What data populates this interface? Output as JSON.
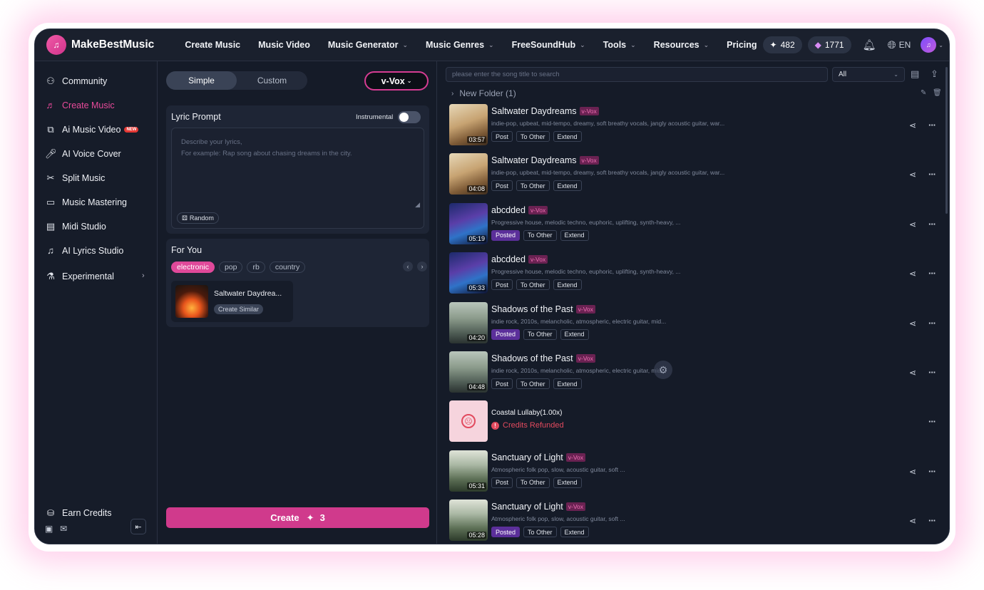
{
  "brand": {
    "name": "MakeBestMusic",
    "logo_icon": "music-note-logo"
  },
  "topnav": {
    "items": [
      {
        "label": "Create Music",
        "has_menu": false
      },
      {
        "label": "Music Video",
        "has_menu": false
      },
      {
        "label": "Music Generator",
        "has_menu": true
      },
      {
        "label": "Music Genres",
        "has_menu": true
      },
      {
        "label": "FreeSoundHub",
        "has_menu": true
      },
      {
        "label": "Tools",
        "has_menu": true
      },
      {
        "label": "Resources",
        "has_menu": true
      },
      {
        "label": "Pricing",
        "has_menu": false
      }
    ],
    "credits": "482",
    "gems": "1771",
    "language": "EN"
  },
  "sidebar": {
    "items": [
      {
        "label": "Community",
        "icon": "community-icon"
      },
      {
        "label": "Create Music",
        "icon": "music-note-icon",
        "active": true
      },
      {
        "label": "Ai Music Video",
        "icon": "video-icon",
        "badge": "NEW"
      },
      {
        "label": "AI Voice Cover",
        "icon": "microphone-icon"
      },
      {
        "label": "Split Music",
        "icon": "split-icon"
      },
      {
        "label": "Music Mastering",
        "icon": "mastering-icon"
      },
      {
        "label": "Midi Studio",
        "icon": "midi-icon"
      },
      {
        "label": "AI Lyrics Studio",
        "icon": "lyrics-icon"
      },
      {
        "label": "Experimental",
        "icon": "flask-icon",
        "has_submenu": true
      }
    ],
    "earn_credits": "Earn Credits"
  },
  "composer": {
    "modes": [
      "Simple",
      "Custom"
    ],
    "active_mode": "Simple",
    "model": "v-Vox",
    "lyric_prompt_label": "Lyric Prompt",
    "instrumental_label": "Instrumental",
    "instrumental_on": false,
    "lyric_placeholder_line1": "Describe your lyrics,",
    "lyric_placeholder_line2": "For example: Rap song about chasing dreams in the city.",
    "random_label": "Random",
    "for_you_label": "For You",
    "genres": [
      "electronic",
      "pop",
      "rb",
      "country"
    ],
    "active_genre": "electronic",
    "suggestion": {
      "title": "Saltwater Daydrea...",
      "button": "Create Similar"
    },
    "create_label": "Create",
    "create_cost": "3"
  },
  "library": {
    "search_placeholder": "please enter the song title to search",
    "filter_value": "All",
    "folder": "New Folder (1)",
    "songs": [
      {
        "title": "Saltwater Daydreams",
        "tag": "v-Vox",
        "duration": "03:57",
        "desc": "indie-pop, upbeat, mid-tempo, dreamy, soft breathy vocals, jangly acoustic guitar, war...",
        "status": "Post",
        "thumb": "th-coffee"
      },
      {
        "title": "Saltwater Daydreams",
        "tag": "v-Vox",
        "duration": "04:08",
        "desc": "indie-pop, upbeat, mid-tempo, dreamy, soft breathy vocals, jangly acoustic guitar, war...",
        "status": "Post",
        "thumb": "th-coffee"
      },
      {
        "title": "abcdded",
        "tag": "v-Vox",
        "duration": "05:19",
        "desc": "Progressive house, melodic techno, euphoric, uplifting, synth-heavy, ...",
        "status": "Posted",
        "thumb": "th-city"
      },
      {
        "title": "abcdded",
        "tag": "v-Vox",
        "duration": "05:33",
        "desc": "Progressive house, melodic techno, euphoric, uplifting, synth-heavy, ...",
        "status": "Post",
        "thumb": "th-city"
      },
      {
        "title": "Shadows of the Past",
        "tag": "v-Vox",
        "duration": "04:20",
        "desc": "indie rock, 2010s, melancholic, atmospheric, electric guitar, mid...",
        "status": "Posted",
        "thumb": "th-fog"
      },
      {
        "title": "Shadows of the Past",
        "tag": "v-Vox",
        "duration": "04:48",
        "desc": "indie rock, 2010s, melancholic, atmospheric, electric guitar, mid...",
        "status": "Post",
        "thumb": "th-fog"
      },
      {
        "title": "Coastal Lullaby(1.00x)",
        "failed": true,
        "error": "Credits Refunded",
        "thumb": "th-sad"
      },
      {
        "title": "Sanctuary of Light",
        "tag": "v-Vox",
        "duration": "05:31",
        "desc": "Atmospheric folk pop, slow, acoustic guitar, soft ...",
        "status": "Post",
        "thumb": "th-pavilion"
      },
      {
        "title": "Sanctuary of Light",
        "tag": "v-Vox",
        "duration": "05:28",
        "desc": "Atmospheric folk pop, slow, acoustic guitar, soft ...",
        "status": "Posted",
        "thumb": "th-pavilion"
      }
    ],
    "action_to_other": "To Other",
    "action_extend": "Extend"
  }
}
